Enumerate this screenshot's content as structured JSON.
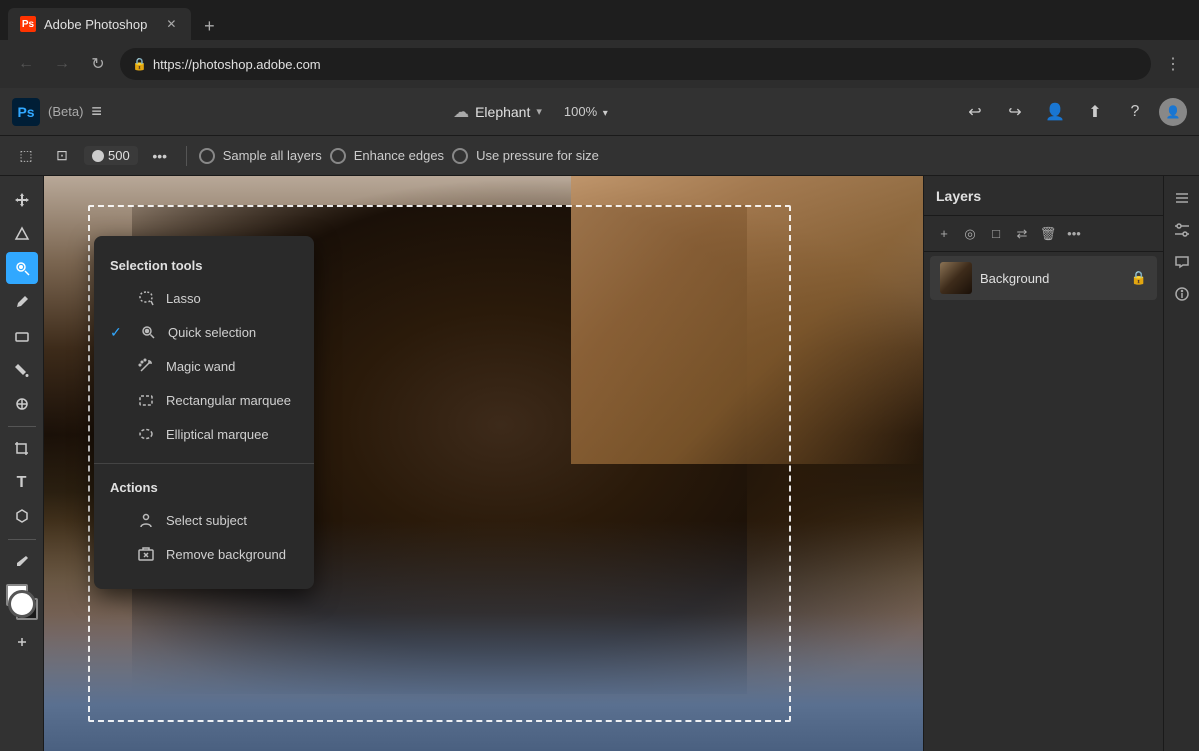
{
  "browser": {
    "tab_title": "Adobe Photoshop",
    "tab_favicon": "Ps",
    "url": "https://photoshop.adobe.com",
    "new_tab_label": "+",
    "nav": {
      "back": "←",
      "forward": "→",
      "reload": "↻",
      "menu": "⋮"
    }
  },
  "app_header": {
    "logo": "Ps",
    "beta": "(Beta)",
    "hamburger": "≡",
    "title": "Elephant",
    "zoom": "100%",
    "title_chevron": "▾",
    "zoom_chevron": "▾",
    "actions": {
      "undo": "↩",
      "redo": "↪",
      "user": "👤",
      "upload": "⬆",
      "help": "?",
      "avatar_text": "👤"
    }
  },
  "toolbar": {
    "tools": [
      "□□",
      "⊡",
      "●"
    ],
    "size_value": "500",
    "more": "•••",
    "sample_all_layers": "Sample all layers",
    "enhance_edges": "Enhance edges",
    "use_pressure": "Use pressure for size"
  },
  "tools_sidebar": {
    "items": [
      {
        "name": "select-tool",
        "icon": "⬚",
        "active": false
      },
      {
        "name": "lasso-tool",
        "icon": "⌒",
        "active": false
      },
      {
        "name": "quick-selection-tool",
        "icon": "✦",
        "active": true
      },
      {
        "name": "brush-tool",
        "icon": "✏",
        "active": false
      },
      {
        "name": "eraser-tool",
        "icon": "◻",
        "active": false
      },
      {
        "name": "fill-tool",
        "icon": "◈",
        "active": false
      },
      {
        "name": "clone-tool",
        "icon": "⊕",
        "active": false
      },
      {
        "name": "crop-tool",
        "icon": "⊞",
        "active": false
      },
      {
        "name": "type-tool",
        "icon": "T",
        "active": false
      },
      {
        "name": "transform-tool",
        "icon": "⬡",
        "active": false
      },
      {
        "name": "eyedropper-tool",
        "icon": "⊘",
        "active": false
      },
      {
        "name": "hand-tool",
        "icon": "✋",
        "active": false
      },
      {
        "name": "zoom-tool",
        "icon": "⊕",
        "active": false
      }
    ]
  },
  "tool_panel": {
    "section_tools": "Selection tools",
    "items": [
      {
        "name": "lasso",
        "label": "Lasso",
        "checked": false,
        "icon": "○"
      },
      {
        "name": "quick-selection",
        "label": "Quick selection",
        "checked": true,
        "icon": "✦"
      },
      {
        "name": "magic-wand",
        "label": "Magic wand",
        "checked": false,
        "icon": "✳"
      },
      {
        "name": "rectangular-marquee",
        "label": "Rectangular marquee",
        "checked": false,
        "icon": "⬚"
      },
      {
        "name": "elliptical-marquee",
        "label": "Elliptical marquee",
        "checked": false,
        "icon": "○"
      }
    ],
    "section_actions": "Actions",
    "actions": [
      {
        "name": "select-subject",
        "label": "Select subject",
        "icon": "👤"
      },
      {
        "name": "remove-background",
        "label": "Remove background",
        "icon": "🏔"
      }
    ]
  },
  "layers_panel": {
    "title": "Layers",
    "actions": [
      "+",
      "◎",
      "□",
      "↔",
      "🗑",
      "•••"
    ],
    "layers": [
      {
        "name": "Background",
        "locked": true
      }
    ]
  }
}
